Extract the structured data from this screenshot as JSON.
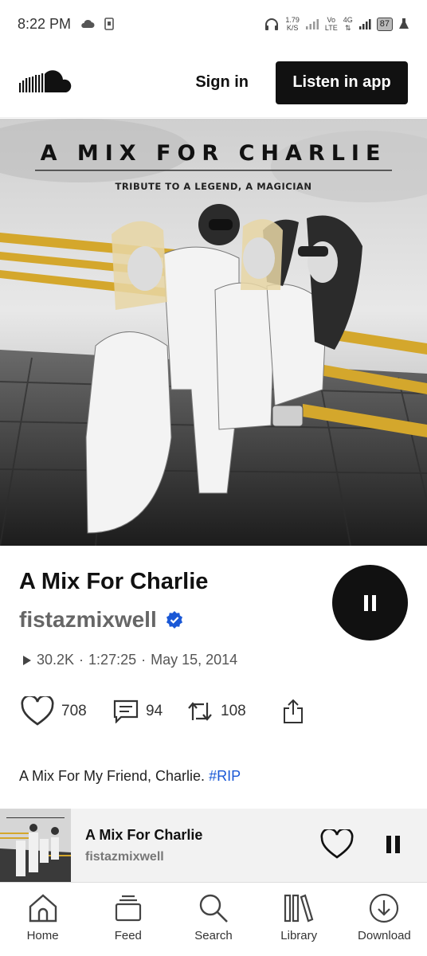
{
  "status_bar": {
    "time": "8:22 PM",
    "speed_value": "1.79",
    "speed_unit": "K/S",
    "volte_top": "Vo",
    "volte_bottom": "LTE",
    "net_top": "4G",
    "battery": "87"
  },
  "header": {
    "signin_label": "Sign in",
    "listen_label": "Listen in app"
  },
  "artwork": {
    "title": "A MIX FOR CHARLIE",
    "subtitle": "TRIBUTE TO A LEGEND, A MAGICIAN",
    "accent_color": "#d4a72c"
  },
  "track": {
    "title": "A Mix For Charlie",
    "artist": "fistazmixwell",
    "plays": "30.2K",
    "duration": "1:27:25",
    "date": "May 15, 2014",
    "sep1": "·",
    "sep2": "·",
    "likes": "708",
    "comments": "94",
    "reposts": "108",
    "description_text": "A Mix For My Friend, Charlie.",
    "hashtag": "#RIP"
  },
  "mini_player": {
    "title": "A Mix For Charlie",
    "artist": "fistazmixwell"
  },
  "nav": [
    {
      "label": "Home",
      "icon": "home-icon"
    },
    {
      "label": "Feed",
      "icon": "feed-icon"
    },
    {
      "label": "Search",
      "icon": "search-icon"
    },
    {
      "label": "Library",
      "icon": "library-icon"
    },
    {
      "label": "Download",
      "icon": "download-icon"
    }
  ],
  "colors": {
    "verified": "#1a58d6",
    "hashtag": "#1a58d6",
    "dark": "#111111"
  }
}
